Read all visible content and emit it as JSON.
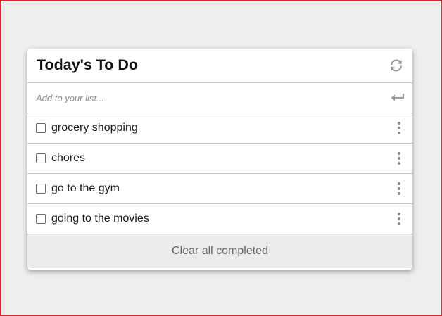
{
  "card": {
    "title": "Today's To Do",
    "refresh_icon": "refresh-icon"
  },
  "add": {
    "placeholder": "Add to your list...",
    "value": "",
    "submit_icon": "enter-return-icon"
  },
  "items": [
    {
      "label": "grocery shopping",
      "checked": false
    },
    {
      "label": "chores",
      "checked": false
    },
    {
      "label": "go to the gym",
      "checked": false
    },
    {
      "label": "going to the movies",
      "checked": false
    }
  ],
  "footer": {
    "clear_label": "Clear all completed"
  },
  "colors": {
    "page_background": "#eeeeee",
    "page_border": "#d9262b",
    "card_background": "#ffffff",
    "footer_background": "#ececec",
    "icon_gray": "#9a9a9a"
  }
}
